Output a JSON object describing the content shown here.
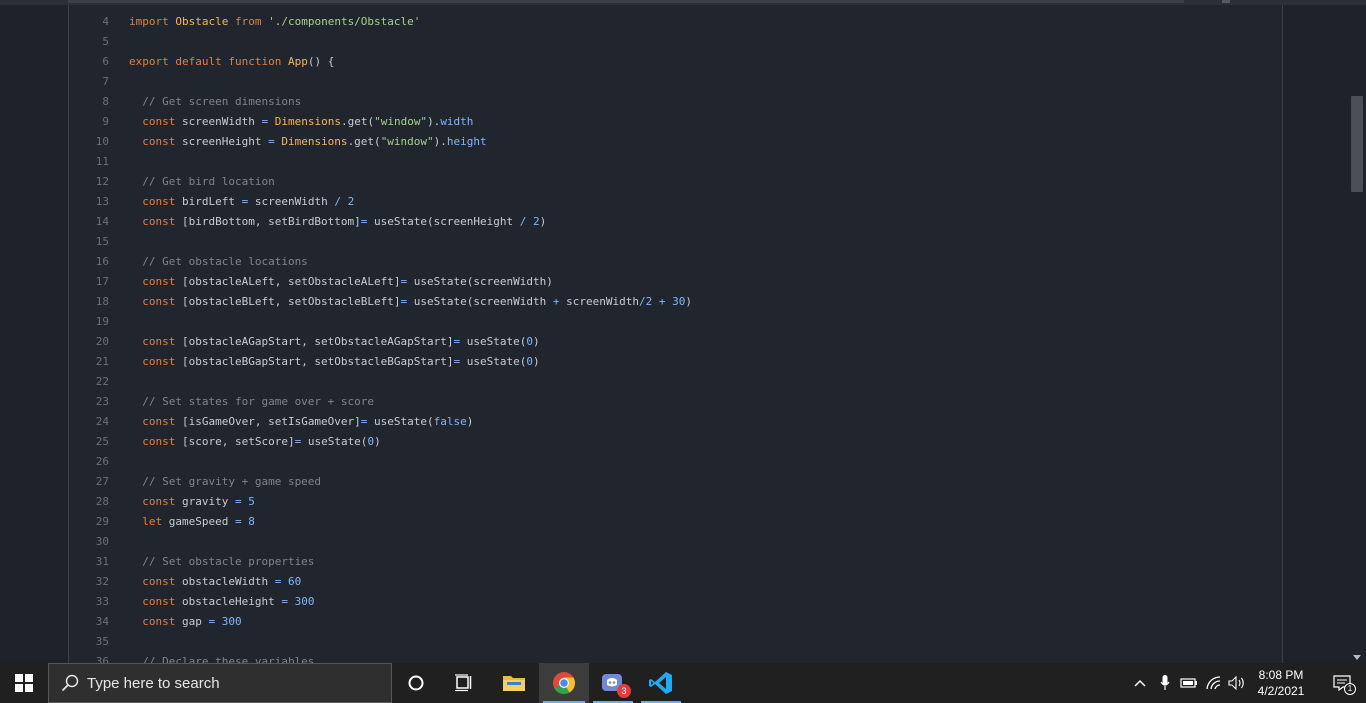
{
  "editor": {
    "lines": [
      {
        "n": "4",
        "tokens": [
          {
            "c": "kw",
            "t": "import "
          },
          {
            "c": "fn",
            "t": "Obstacle "
          },
          {
            "c": "kw",
            "t": "from "
          },
          {
            "c": "str",
            "t": "'./components/Obstacle'"
          }
        ]
      },
      {
        "n": "5",
        "tokens": []
      },
      {
        "n": "6",
        "tokens": [
          {
            "c": "kw",
            "t": "export default function "
          },
          {
            "c": "fn",
            "t": "App"
          },
          {
            "c": "",
            "t": "() {"
          }
        ]
      },
      {
        "n": "7",
        "tokens": []
      },
      {
        "n": "8",
        "tokens": [
          {
            "c": "cm",
            "t": "  // Get screen dimensions"
          }
        ]
      },
      {
        "n": "9",
        "tokens": [
          {
            "c": "kw",
            "t": "  const "
          },
          {
            "c": "",
            "t": "screenWidth "
          },
          {
            "c": "op",
            "t": "= "
          },
          {
            "c": "fn",
            "t": "Dimensions"
          },
          {
            "c": "",
            "t": ".get("
          },
          {
            "c": "str",
            "t": "\"window\""
          },
          {
            "c": "",
            "t": ")."
          },
          {
            "c": "prop",
            "t": "width"
          }
        ]
      },
      {
        "n": "10",
        "tokens": [
          {
            "c": "kw",
            "t": "  const "
          },
          {
            "c": "",
            "t": "screenHeight "
          },
          {
            "c": "op",
            "t": "= "
          },
          {
            "c": "fn",
            "t": "Dimensions"
          },
          {
            "c": "",
            "t": ".get("
          },
          {
            "c": "str",
            "t": "\"window\""
          },
          {
            "c": "",
            "t": ")."
          },
          {
            "c": "prop",
            "t": "height"
          }
        ]
      },
      {
        "n": "11",
        "tokens": []
      },
      {
        "n": "12",
        "tokens": [
          {
            "c": "cm",
            "t": "  // Get bird location"
          }
        ]
      },
      {
        "n": "13",
        "tokens": [
          {
            "c": "kw",
            "t": "  const "
          },
          {
            "c": "",
            "t": "birdLeft "
          },
          {
            "c": "op",
            "t": "= "
          },
          {
            "c": "",
            "t": "screenWidth "
          },
          {
            "c": "op",
            "t": "/ "
          },
          {
            "c": "num",
            "t": "2"
          }
        ]
      },
      {
        "n": "14",
        "tokens": [
          {
            "c": "kw",
            "t": "  const "
          },
          {
            "c": "",
            "t": "[birdBottom, setBirdBottom]"
          },
          {
            "c": "op",
            "t": "= "
          },
          {
            "c": "",
            "t": "useState(screenHeight "
          },
          {
            "c": "op",
            "t": "/ "
          },
          {
            "c": "num",
            "t": "2"
          },
          {
            "c": "",
            "t": ")"
          }
        ]
      },
      {
        "n": "15",
        "tokens": []
      },
      {
        "n": "16",
        "tokens": [
          {
            "c": "cm",
            "t": "  // Get obstacle locations"
          }
        ]
      },
      {
        "n": "17",
        "tokens": [
          {
            "c": "kw",
            "t": "  const "
          },
          {
            "c": "",
            "t": "[obstacleALeft, setObstacleALeft]"
          },
          {
            "c": "op",
            "t": "= "
          },
          {
            "c": "",
            "t": "useState(screenWidth)"
          }
        ]
      },
      {
        "n": "18",
        "tokens": [
          {
            "c": "kw",
            "t": "  const "
          },
          {
            "c": "",
            "t": "[obstacleBLeft, setObstacleBLeft]"
          },
          {
            "c": "op",
            "t": "= "
          },
          {
            "c": "",
            "t": "useState(screenWidth "
          },
          {
            "c": "op",
            "t": "+ "
          },
          {
            "c": "",
            "t": "screenWidth"
          },
          {
            "c": "op",
            "t": "/"
          },
          {
            "c": "num",
            "t": "2 "
          },
          {
            "c": "op",
            "t": "+ "
          },
          {
            "c": "num",
            "t": "30"
          },
          {
            "c": "",
            "t": ")"
          }
        ]
      },
      {
        "n": "19",
        "tokens": []
      },
      {
        "n": "20",
        "tokens": [
          {
            "c": "kw",
            "t": "  const "
          },
          {
            "c": "",
            "t": "[obstacleAGapStart, setObstacleAGapStart]"
          },
          {
            "c": "op",
            "t": "= "
          },
          {
            "c": "",
            "t": "useState("
          },
          {
            "c": "num",
            "t": "0"
          },
          {
            "c": "",
            "t": ")"
          }
        ]
      },
      {
        "n": "21",
        "tokens": [
          {
            "c": "kw",
            "t": "  const "
          },
          {
            "c": "",
            "t": "[obstacleBGapStart, setObstacleBGapStart]"
          },
          {
            "c": "op",
            "t": "= "
          },
          {
            "c": "",
            "t": "useState("
          },
          {
            "c": "num",
            "t": "0"
          },
          {
            "c": "",
            "t": ")"
          }
        ]
      },
      {
        "n": "22",
        "tokens": []
      },
      {
        "n": "23",
        "tokens": [
          {
            "c": "cm",
            "t": "  // Set states for game over + score"
          }
        ]
      },
      {
        "n": "24",
        "tokens": [
          {
            "c": "kw",
            "t": "  const "
          },
          {
            "c": "",
            "t": "[isGameOver, setIsGameOver]"
          },
          {
            "c": "op",
            "t": "= "
          },
          {
            "c": "",
            "t": "useState("
          },
          {
            "c": "num",
            "t": "false"
          },
          {
            "c": "",
            "t": ")"
          }
        ]
      },
      {
        "n": "25",
        "tokens": [
          {
            "c": "kw",
            "t": "  const "
          },
          {
            "c": "",
            "t": "[score, setScore]"
          },
          {
            "c": "op",
            "t": "= "
          },
          {
            "c": "",
            "t": "useState("
          },
          {
            "c": "num",
            "t": "0"
          },
          {
            "c": "",
            "t": ")"
          }
        ]
      },
      {
        "n": "26",
        "tokens": []
      },
      {
        "n": "27",
        "tokens": [
          {
            "c": "cm",
            "t": "  // Set gravity + game speed"
          }
        ]
      },
      {
        "n": "28",
        "tokens": [
          {
            "c": "kw",
            "t": "  const "
          },
          {
            "c": "",
            "t": "gravity "
          },
          {
            "c": "op",
            "t": "= "
          },
          {
            "c": "num",
            "t": "5"
          }
        ]
      },
      {
        "n": "29",
        "tokens": [
          {
            "c": "kw",
            "t": "  let "
          },
          {
            "c": "",
            "t": "gameSpeed "
          },
          {
            "c": "op",
            "t": "= "
          },
          {
            "c": "num",
            "t": "8"
          }
        ]
      },
      {
        "n": "30",
        "tokens": []
      },
      {
        "n": "31",
        "tokens": [
          {
            "c": "cm",
            "t": "  // Set obstacle properties"
          }
        ]
      },
      {
        "n": "32",
        "tokens": [
          {
            "c": "kw",
            "t": "  const "
          },
          {
            "c": "",
            "t": "obstacleWidth "
          },
          {
            "c": "op",
            "t": "= "
          },
          {
            "c": "num",
            "t": "60"
          }
        ]
      },
      {
        "n": "33",
        "tokens": [
          {
            "c": "kw",
            "t": "  const "
          },
          {
            "c": "",
            "t": "obstacleHeight "
          },
          {
            "c": "op",
            "t": "= "
          },
          {
            "c": "num",
            "t": "300"
          }
        ]
      },
      {
        "n": "34",
        "tokens": [
          {
            "c": "kw",
            "t": "  const "
          },
          {
            "c": "",
            "t": "gap "
          },
          {
            "c": "op",
            "t": "= "
          },
          {
            "c": "num",
            "t": "300"
          }
        ]
      },
      {
        "n": "35",
        "tokens": []
      },
      {
        "n": "36",
        "tokens": [
          {
            "c": "cm",
            "t": "  // Declare these variables"
          }
        ]
      }
    ]
  },
  "taskbar": {
    "search_placeholder": "Type here to search",
    "discord_badge": "3",
    "time": "8:08 PM",
    "date": "4/2/2021",
    "notification_count": "1"
  }
}
